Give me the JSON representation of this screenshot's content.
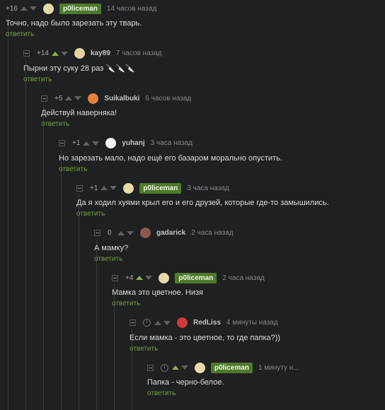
{
  "reply_label": "ответить",
  "comments": [
    {
      "rating": "+16",
      "up": false,
      "author": "p0liceman",
      "badge": true,
      "avatar_color": "#e8d9a8",
      "time": "14 часов назад",
      "text": "Точно, надо было зарезать эту тварь."
    },
    {
      "rating": "+14",
      "up": true,
      "author": "kay89",
      "badge": false,
      "avatar_color": "#e7d3a0",
      "time": "7 часов назад",
      "text": "Пырни эту суку 28 раз 🔪🔪🔪"
    },
    {
      "rating": "+5",
      "up": false,
      "author": "Suikalbuki",
      "badge": false,
      "avatar_color": "#e3823a",
      "time": "6 часов назад",
      "text": "Действуй наверняка!"
    },
    {
      "rating": "+1",
      "up": false,
      "author": "yuhanj",
      "badge": false,
      "avatar_color": "#f2f2f2",
      "time": "3 часа назад",
      "text": "Но зарезать мало, надо ещё его базаром морально опустить."
    },
    {
      "rating": "+1",
      "up": false,
      "author": "p0liceman",
      "badge": true,
      "avatar_color": "#e8d9a8",
      "time": "3 часа назад",
      "text": "Да я ходил хуями крыл его и его друзей, которые где-то замышились."
    },
    {
      "rating": "0",
      "up": false,
      "author": "gadarick",
      "badge": false,
      "avatar_color": "#8a5a4a",
      "time": "2 часа назад",
      "text": "А мамку?"
    },
    {
      "rating": "+4",
      "up": true,
      "author": "p0liceman",
      "badge": true,
      "avatar_color": "#e8d9a8",
      "time": "2 часа назад",
      "text": "Мамка это цветное. Низя"
    },
    {
      "rating": "",
      "up": false,
      "author": "RedLiss",
      "badge": false,
      "avatar_color": "#d23a3a",
      "time": "4 минуты назад",
      "text": "Если мамка - это цветное, то где папка?))",
      "clock": true
    },
    {
      "rating": "",
      "up": true,
      "author": "p0liceman",
      "badge": true,
      "avatar_color": "#e8d9a8",
      "time": "1 минуту н...",
      "text": "Папка - черно-белое.",
      "clock": true
    }
  ]
}
